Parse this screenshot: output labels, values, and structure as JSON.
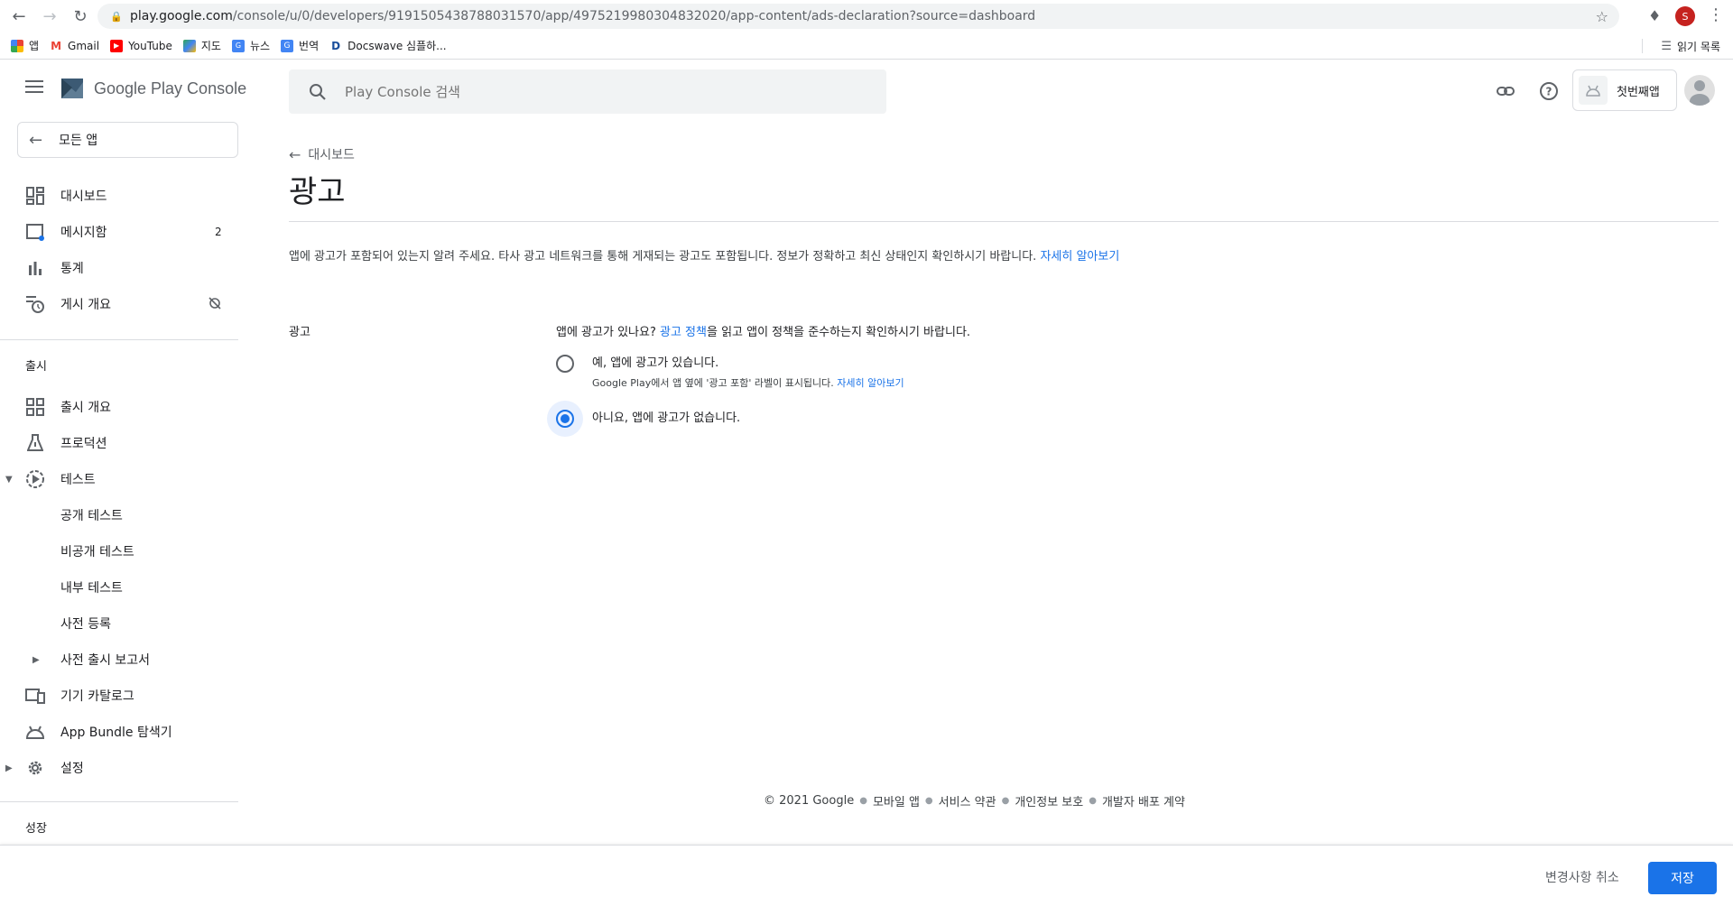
{
  "browser": {
    "url_host": "play.google.com",
    "url_path": "/console/u/0/developers/9191505438788031570/app/4975219980304832020/app-content/ads-declaration?source=dashboard",
    "profile_initial": "S",
    "bookmarks": [
      {
        "label": "앱"
      },
      {
        "label": "Gmail"
      },
      {
        "label": "YouTube"
      },
      {
        "label": "지도"
      },
      {
        "label": "뉴스"
      },
      {
        "label": "번역"
      },
      {
        "label": "Docswave 심플하..."
      }
    ],
    "reading_list": "읽기 목록"
  },
  "header": {
    "logo_text": "Google Play Console",
    "search_placeholder": "Play Console 검색",
    "app_name": "첫번째앱"
  },
  "sidebar": {
    "all_apps": "모든 앱",
    "items": [
      {
        "label": "대시보드"
      },
      {
        "label": "메시지함",
        "badge": "2"
      },
      {
        "label": "통계"
      },
      {
        "label": "게시 개요"
      }
    ],
    "release_section": "출시",
    "release_items": [
      {
        "label": "출시 개요"
      },
      {
        "label": "프로덕션"
      },
      {
        "label": "테스트"
      },
      {
        "label": "공개 테스트"
      },
      {
        "label": "비공개 테스트"
      },
      {
        "label": "내부 테스트"
      },
      {
        "label": "사전 등록"
      },
      {
        "label": "사전 출시 보고서"
      },
      {
        "label": "기기 카탈로그"
      },
      {
        "label": "App Bundle 탐색기"
      },
      {
        "label": "설정"
      }
    ],
    "growth_section": "성장"
  },
  "main": {
    "back_label": "대시보드",
    "title": "광고",
    "intro_text": "앱에 광고가 포함되어 있는지 알려 주세요. 타사 광고 네트워크를 통해 게재되는 광고도 포함됩니다. 정보가 정확하고 최신 상태인지 확인하시기 바랍니다.",
    "intro_link": "자세히 알아보기",
    "section_label": "광고",
    "question_prefix": "앱에 광고가 있나요?",
    "question_link": "광고 정책",
    "question_suffix": "을 읽고 앱이 정책을 준수하는지 확인하시기 바랍니다.",
    "options": [
      {
        "label": "예, 앱에 광고가 있습니다.",
        "help": "Google Play에서 앱 옆에 '광고 포함' 라벨이 표시됩니다.",
        "help_link": "자세히 알아보기",
        "selected": false
      },
      {
        "label": "아니요, 앱에 광고가 없습니다.",
        "selected": true
      }
    ]
  },
  "footer": {
    "copyright": "© 2021 Google",
    "links": [
      "모바일 앱",
      "서비스 약관",
      "개인정보 보호",
      "개발자 배포 계약"
    ]
  },
  "bottom_bar": {
    "discard_label": "변경사항 취소",
    "save_label": "저장"
  },
  "colors": {
    "accent": "#1a73e8",
    "text": "#202124",
    "muted": "#5f6368",
    "divider": "#dadce0"
  }
}
